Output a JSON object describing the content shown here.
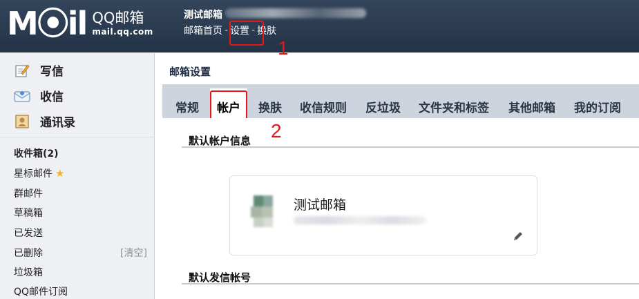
{
  "header": {
    "logo_mail": "M⦿il",
    "logo_qq": "QQ邮箱",
    "logo_domain": "mail.qq.com",
    "account_title": "测试邮箱",
    "links": [
      "邮箱首页",
      "设置",
      "换肤"
    ],
    "link_separator": "-"
  },
  "annotations": {
    "step1": "1",
    "step2": "2"
  },
  "sidebar": {
    "actions": [
      {
        "label": "写信",
        "icon": "pencil-paper-icon"
      },
      {
        "label": "收信",
        "icon": "envelope-icon"
      },
      {
        "label": "通讯录",
        "icon": "contacts-book-icon"
      }
    ],
    "folders": [
      {
        "label": "收件箱(2)",
        "bold": true
      },
      {
        "label": "星标邮件",
        "icon": "star-icon"
      },
      {
        "label": "群邮件"
      },
      {
        "label": "草稿箱"
      },
      {
        "label": "已发送"
      },
      {
        "label": "已删除",
        "extra": "[清空]"
      },
      {
        "label": "垃圾箱"
      },
      {
        "label": "QQ邮件订阅"
      }
    ]
  },
  "main": {
    "title": "邮箱设置",
    "tabs": [
      "常规",
      "帐户",
      "换肤",
      "收信规则",
      "反垃圾",
      "文件夹和标签",
      "其他邮箱",
      "我的订阅"
    ],
    "active_tab": "帐户",
    "section1_title": "默认帐户信息",
    "card_name": "测试邮箱",
    "section2_title": "默认发信帐号"
  },
  "colors": {
    "header_bg": "#2a3a4f",
    "highlight_red": "#e61717",
    "tabbar_bg": "#cdd4de",
    "sidebar_bg": "#eef0f3"
  }
}
